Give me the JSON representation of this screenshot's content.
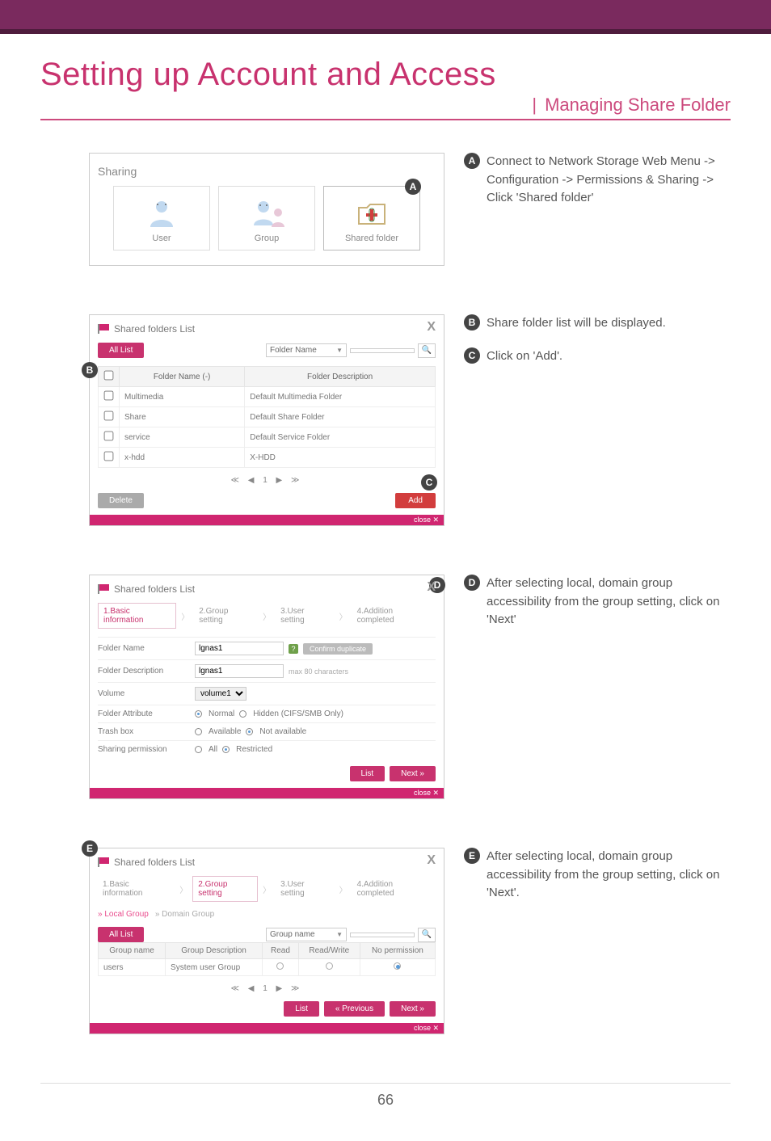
{
  "page": {
    "title": "Setting up Account and Access",
    "subtitle": "Managing Share Folder",
    "number": "66"
  },
  "callouts": {
    "A": "Connect to Network Storage Web Menu -> Configuration -> Permissions & Sharing -> Click 'Shared folder'",
    "B": "Share folder list will be displayed.",
    "C": "Click on 'Add'.",
    "D": "After selecting local, domain group accessibility from the group setting, click on 'Next'",
    "E": "After selecting local, domain group accessibility from the group setting, click on 'Next'."
  },
  "panelA": {
    "title": "Sharing",
    "tiles": [
      {
        "label": "User"
      },
      {
        "label": "Group"
      },
      {
        "label": "Shared folder"
      }
    ]
  },
  "panelB": {
    "title": "Shared folders List",
    "tab": "All List",
    "search_field": "Folder Name",
    "headers": {
      "name": "Folder Name (-)",
      "desc": "Folder Description"
    },
    "rows": [
      {
        "name": "Multimedia",
        "desc": "Default Multimedia Folder"
      },
      {
        "name": "Share",
        "desc": "Default Share Folder"
      },
      {
        "name": "service",
        "desc": "Default Service Folder"
      },
      {
        "name": "x-hdd",
        "desc": "X-HDD"
      }
    ],
    "pager": "1",
    "delete": "Delete",
    "add": "Add",
    "close": "close"
  },
  "panelD": {
    "title": "Shared folders List",
    "steps": {
      "s1": "1.Basic information",
      "s2": "2.Group setting",
      "s3": "3.User setting",
      "s4": "4.Addition completed"
    },
    "fields": {
      "folder_name_label": "Folder Name",
      "folder_name_value": "lgnas1",
      "confirm_dup": "Confirm duplicate",
      "folder_desc_label": "Folder Description",
      "folder_desc_value": "lgnas1",
      "desc_hint": "max 80 characters",
      "volume_label": "Volume",
      "volume_value": "volume1",
      "attr_label": "Folder Attribute",
      "attr_opt1": "Normal",
      "attr_opt2": "Hidden (CIFS/SMB Only)",
      "trash_label": "Trash box",
      "trash_opt1": "Available",
      "trash_opt2": "Not available",
      "perm_label": "Sharing permission",
      "perm_opt1": "All",
      "perm_opt2": "Restricted"
    },
    "buttons": {
      "list": "List",
      "next": "Next »"
    },
    "close": "close"
  },
  "panelE": {
    "title": "Shared folders List",
    "steps": {
      "s1": "1.Basic information",
      "s2": "2.Group setting",
      "s3": "3.User setting",
      "s4": "4.Addition completed"
    },
    "subtabs": {
      "local": "» Local Group",
      "domain": "» Domain Group"
    },
    "tab": "All List",
    "search_field": "Group name",
    "headers": {
      "name": "Group name",
      "desc": "Group Description",
      "read": "Read",
      "rw": "Read/Write",
      "np": "No permission"
    },
    "row": {
      "name": "users",
      "desc": "System user Group"
    },
    "pager": "1",
    "buttons": {
      "list": "List",
      "prev": "« Previous",
      "next": "Next »"
    },
    "close": "close"
  }
}
